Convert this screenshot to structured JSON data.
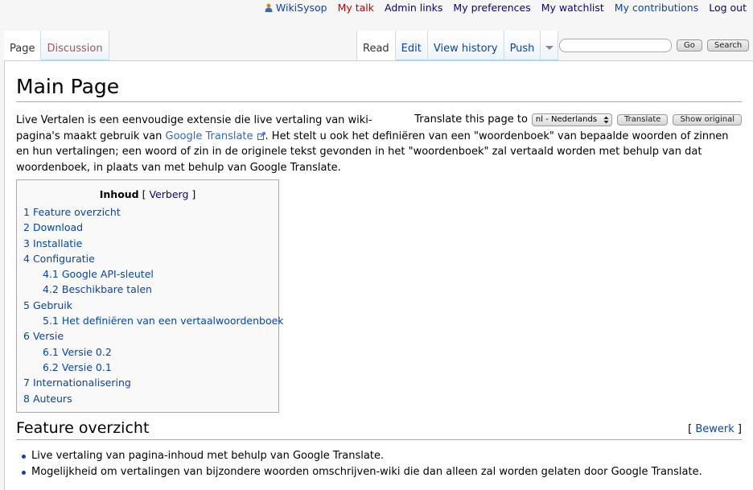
{
  "personal_tools": {
    "user": "WikiSysop",
    "talk": "My talk",
    "admin": "Admin links",
    "preferences": "My preferences",
    "watchlist": "My watchlist",
    "contributions": "My contributions",
    "logout": "Log out"
  },
  "namespace_tabs": [
    {
      "label": "Page",
      "selected": true
    },
    {
      "label": "Discussion",
      "selected": false
    }
  ],
  "view_tabs": [
    {
      "label": "Read",
      "selected": true
    },
    {
      "label": "Edit",
      "selected": false
    },
    {
      "label": "View history",
      "selected": false
    },
    {
      "label": "Push",
      "selected": false
    }
  ],
  "search": {
    "value": "",
    "placeholder": "",
    "go_label": "Go",
    "search_label": "Search"
  },
  "page": {
    "title": "Main Page",
    "translate": {
      "label": "Translate this page to",
      "selected_language": "nl - Nederlands",
      "translate_button": "Translate",
      "show_original_button": "Show original"
    },
    "intro_before_link": "Live Vertalen is een eenvoudige extensie die live vertaling van wiki-pagina's maakt gebruik van ",
    "intro_link": "Google Translate",
    "intro_after_link": ". Het stelt u ook het definiëren van een \"woordenboek\" van bepaalde woorden of zinnen en hun vertalingen; een woord of zin in de originele tekst gevonden in het \"woordenboek\" zal vertaald worden met behulp van dat woordenboek, in plaats van met behulp van Google Translate."
  },
  "toc": {
    "title": "Inhoud",
    "toggle": "Verberg",
    "items": [
      {
        "number": "1",
        "label": "Feature overzicht",
        "level": 1
      },
      {
        "number": "2",
        "label": "Download",
        "level": 1
      },
      {
        "number": "3",
        "label": "Installatie",
        "level": 1
      },
      {
        "number": "4",
        "label": "Configuratie",
        "level": 1
      },
      {
        "number": "4.1",
        "label": "Google API-sleutel",
        "level": 2
      },
      {
        "number": "4.2",
        "label": "Beschikbare talen",
        "level": 2
      },
      {
        "number": "5",
        "label": "Gebruik",
        "level": 1
      },
      {
        "number": "5.1",
        "label": "Het definiëren van een vertaalwoordenboek",
        "level": 2
      },
      {
        "number": "6",
        "label": "Versie",
        "level": 1
      },
      {
        "number": "6.1",
        "label": "Versie 0.2",
        "level": 2
      },
      {
        "number": "6.2",
        "label": "Versie 0.1",
        "level": 2
      },
      {
        "number": "7",
        "label": "Internationalisering",
        "level": 1
      },
      {
        "number": "8",
        "label": "Auteurs",
        "level": 1
      }
    ]
  },
  "section": {
    "title": "Feature overzicht",
    "edit_label": "Bewerk",
    "bullets": [
      "Live vertaling van pagina-inhoud met behulp van Google Translate.",
      "Mogelijkheid om vertalingen van bijzondere woorden omschrijven-wiki die dan alleen zal worden gelaten door Google Translate."
    ]
  }
}
